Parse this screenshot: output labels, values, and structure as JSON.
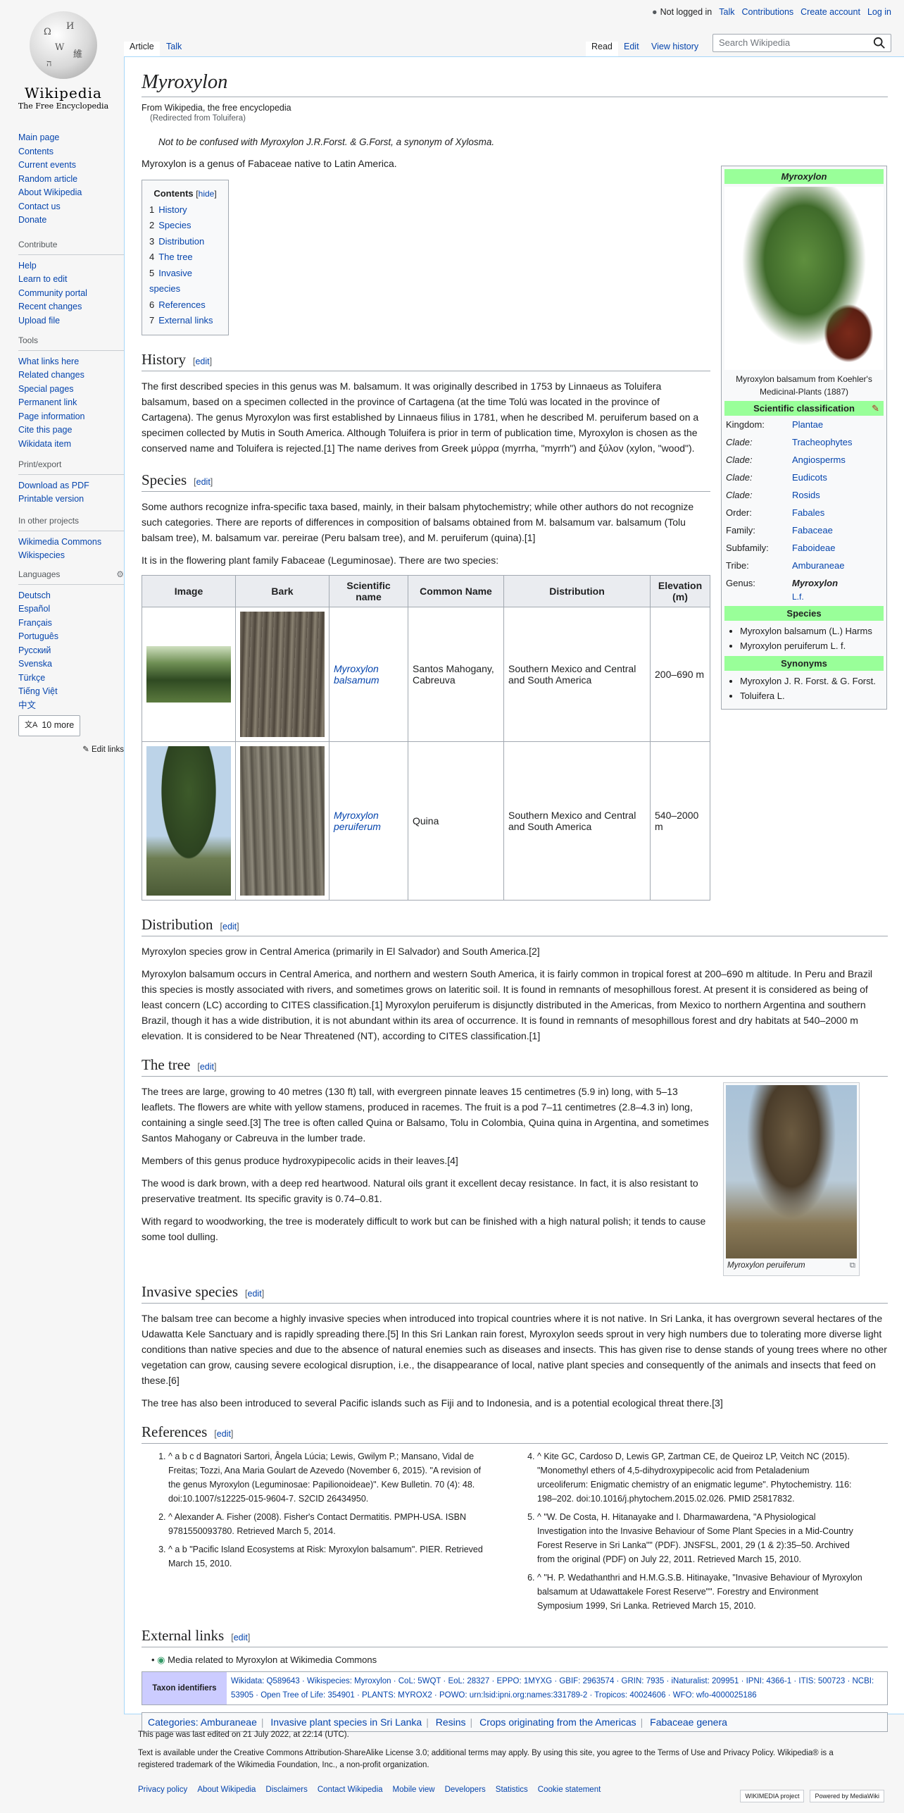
{
  "header": {
    "not_logged_in": "Not logged in",
    "talk": "Talk",
    "contributions": "Contributions",
    "create_account": "Create account",
    "log_in": "Log in",
    "tabs": {
      "article": "Article",
      "talk": "Talk",
      "read": "Read",
      "edit": "Edit",
      "view_history": "View history"
    },
    "search_placeholder": "Search Wikipedia"
  },
  "logo": {
    "wordmark": "Wikipedia",
    "tagline": "The Free Encyclopedia"
  },
  "sidebar": {
    "nav": [
      "Main page",
      "Contents",
      "Current events",
      "Random article",
      "About Wikipedia",
      "Contact us",
      "Donate"
    ],
    "contribute_heading": "Contribute",
    "contribute": [
      "Help",
      "Learn to edit",
      "Community portal",
      "Recent changes",
      "Upload file"
    ],
    "tools_heading": "Tools",
    "tools": [
      "What links here",
      "Related changes",
      "Special pages",
      "Permanent link",
      "Page information",
      "Cite this page",
      "Wikidata item"
    ],
    "print_heading": "Print/export",
    "print": [
      "Download as PDF",
      "Printable version"
    ],
    "projects_heading": "In other projects",
    "projects": [
      "Wikimedia Commons",
      "Wikispecies"
    ],
    "languages_heading": "Languages",
    "languages": [
      "Deutsch",
      "Español",
      "Français",
      "Português",
      "Русский",
      "Svenska",
      "Türkçe",
      "Tiếng Việt",
      "中文"
    ],
    "more_languages": "10 more",
    "edit_links": "Edit links"
  },
  "article": {
    "title": "Myroxylon",
    "from": "From Wikipedia, the free encyclopedia",
    "redirected": "(Redirected from Toluifera)",
    "hatnote": "Not to be confused with Myroxylon J.R.Forst. & G.Forst, a synonym of Xylosma.",
    "intro": "Myroxylon is a genus of Fabaceae native to Latin America.",
    "edit": "edit",
    "toc": {
      "title": "Contents",
      "hide": "hide",
      "items": [
        {
          "n": "1",
          "label": "History"
        },
        {
          "n": "2",
          "label": "Species"
        },
        {
          "n": "3",
          "label": "Distribution"
        },
        {
          "n": "4",
          "label": "The tree"
        },
        {
          "n": "5",
          "label": "Invasive species"
        },
        {
          "n": "6",
          "label": "References"
        },
        {
          "n": "7",
          "label": "External links"
        }
      ]
    },
    "history": {
      "heading": "History",
      "p1": "The first described species in this genus was M. balsamum. It was originally described in 1753 by Linnaeus as Toluifera balsamum, based on a specimen collected in the province of Cartagena (at the time Tolú was located in the province of Cartagena). The genus Myroxylon was first established by Linnaeus filius in 1781, when he described M. peruiferum based on a specimen collected by Mutis in South America. Although Toluifera is prior in term of publication time, Myroxylon is chosen as the conserved name and Toluifera is rejected.[1] The name derives from Greek μύρρα (myrrha, \"myrrh\") and ξύλον (xylon, \"wood\")."
    },
    "species": {
      "heading": "Species",
      "p1": "Some authors recognize infra-specific taxa based, mainly, in their balsam phytochemistry; while other authors do not recognize such categories. There are reports of differences in composition of balsams obtained from M. balsamum var. balsamum (Tolu balsam tree), M. balsamum var. pereirae (Peru balsam tree), and M. peruiferum (quina).[1]",
      "p2": "It is in the flowering plant family Fabaceae (Leguminosae). There are two species:",
      "table_headers": [
        "Image",
        "Bark",
        "Scientific name",
        "Common Name",
        "Distribution",
        "Elevation (m)"
      ],
      "rows": [
        {
          "sci": "Myroxylon balsamum",
          "common": "Santos Mahogany, Cabreuva",
          "dist": "Southern Mexico and Central and South America",
          "elev": "200–690 m"
        },
        {
          "sci": "Myroxylon peruiferum",
          "common": "Quina",
          "dist": "Southern Mexico and Central and South America",
          "elev": "540–2000 m"
        }
      ]
    },
    "distribution": {
      "heading": "Distribution",
      "p1": "Myroxylon species grow in Central America (primarily in El Salvador) and South America.[2]",
      "p2": "Myroxylon balsamum occurs in Central America, and northern and western South America, it is fairly common in tropical forest at 200–690 m altitude. In Peru and Brazil this species is mostly associated with rivers, and sometimes grows on lateritic soil. It is found in remnants of mesophillous forest. At present it is considered as being of least concern (LC) according to CITES classification.[1] Myroxylon peruiferum is disjunctly distributed in the Americas, from Mexico to northern Argentina and southern Brazil, though it has a wide distribution, it is not abundant within its area of occurrence. It is found in remnants of mesophillous forest and dry habitats at 540–2000 m elevation. It is considered to be Near Threatened (NT), according to CITES classification.[1]"
    },
    "tree": {
      "heading": "The tree",
      "p1": "The trees are large, growing to 40 metres (130 ft) tall, with evergreen pinnate leaves 15 centimetres (5.9 in) long, with 5–13 leaflets. The flowers are white with yellow stamens, produced in racemes. The fruit is a pod 7–11 centimetres (2.8–4.3 in) long, containing a single seed.[3] The tree is often called Quina or Balsamo, Tolu in Colombia, Quina quina in Argentina, and sometimes Santos Mahogany or Cabreuva in the lumber trade.",
      "p2": "Members of this genus produce hydroxypipecolic acids in their leaves.[4]",
      "p3": "The wood is dark brown, with a deep red heartwood. Natural oils grant it excellent decay resistance. In fact, it is also resistant to preservative treatment. Its specific gravity is 0.74–0.81.",
      "p4": "With regard to woodworking, the tree is moderately difficult to work but can be finished with a high natural polish; it tends to cause some tool dulling.",
      "caption": "Myroxylon peruiferum"
    },
    "invasive": {
      "heading": "Invasive species",
      "p1": "The balsam tree can become a highly invasive species when introduced into tropical countries where it is not native. In Sri Lanka, it has overgrown several hectares of the Udawatta Kele Sanctuary and is rapidly spreading there.[5] In this Sri Lankan rain forest, Myroxylon seeds sprout in very high numbers due to tolerating more diverse light conditions than native species and due to the absence of natural enemies such as diseases and insects. This has given rise to dense stands of young trees where no other vegetation can grow, causing severe ecological disruption, i.e., the disappearance of local, native plant species and consequently of the animals and insects that feed on these.[6]",
      "p2": "The tree has also been introduced to several Pacific islands such as Fiji and to Indonesia, and is a potential ecological threat there.[3]"
    },
    "references": {
      "heading": "References",
      "items": [
        "^ a b c d Bagnatori Sartori, Ângela Lúcia; Lewis, Gwilym P.; Mansano, Vidal de Freitas; Tozzi, Ana Maria Goulart de Azevedo (November 6, 2015). \"A revision of the genus Myroxylon (Leguminosae: Papilionoideae)\". Kew Bulletin. 70 (4): 48. doi:10.1007/s12225-015-9604-7. S2CID 26434950.",
        "^ Alexander A. Fisher (2008). Fisher's Contact Dermatitis. PMPH-USA. ISBN 9781550093780. Retrieved March 5, 2014.",
        "^ a b \"Pacific Island Ecosystems at Risk: Myroxylon balsamum\". PIER. Retrieved March 15, 2010.",
        "^ Kite GC, Cardoso D, Lewis GP, Zartman CE, de Queiroz LP, Veitch NC (2015). \"Monomethyl ethers of 4,5-dihydroxypipecolic acid from Petaladenium urceoliferum: Enigmatic chemistry of an enigmatic legume\". Phytochemistry. 116: 198–202. doi:10.1016/j.phytochem.2015.02.026. PMID 25817832.",
        "^ \"W. De Costa, H. Hitanayake and I. Dharmawardena, \"A Physiological Investigation into the Invasive Behaviour of Some Plant Species in a Mid-Country Forest Reserve in Sri Lanka\"\" (PDF). JNSFSL, 2001, 29 (1 & 2):35–50. Archived from the original (PDF) on July 22, 2011. Retrieved March 15, 2010.",
        "^ \"H. P. Wedathanthri and H.M.G.S.B. Hitinayake, \"Invasive Behaviour of Myroxylon balsamum at Udawattakele Forest Reserve\"\". Forestry and Environment Symposium 1999, Sri Lanka. Retrieved March 15, 2010."
      ]
    },
    "external": {
      "heading": "External links",
      "commons": "Media related to Myroxylon at Wikimedia Commons",
      "taxon_label": "Taxon identifiers",
      "taxon_values": "Wikidata: Q589643 · Wikispecies: Myroxylon · CoL: 5WQT · EoL: 28327 · EPPO: 1MYXG · GBIF: 2963574 · GRIN: 7935 · iNaturalist: 209951 · IPNI: 4366-1 · ITIS: 500723 · NCBI: 53905 · Open Tree of Life: 354901 · PLANTS: MYROX2 · POWO: urn:lsid:ipni.org:names:331789-2 · Tropicos: 40024606 · WFO: wfo-4000025186"
    },
    "categories_label": "Categories:",
    "categories": [
      "Amburaneae",
      "Invasive plant species in Sri Lanka",
      "Resins",
      "Crops originating from the Americas",
      "Fabaceae genera"
    ]
  },
  "infobox": {
    "title": "Myroxylon",
    "caption": "Myroxylon balsamum from Koehler's Medicinal-Plants (1887)",
    "sci_class": "Scientific classification",
    "rows": [
      {
        "k": "Kingdom:",
        "v": "Plantae"
      },
      {
        "k": "Clade:",
        "v": "Tracheophytes"
      },
      {
        "k": "Clade:",
        "v": "Angiosperms"
      },
      {
        "k": "Clade:",
        "v": "Eudicots"
      },
      {
        "k": "Clade:",
        "v": "Rosids"
      },
      {
        "k": "Order:",
        "v": "Fabales"
      },
      {
        "k": "Family:",
        "v": "Fabaceae"
      },
      {
        "k": "Subfamily:",
        "v": "Faboideae"
      },
      {
        "k": "Tribe:",
        "v": "Amburaneae"
      },
      {
        "k": "Genus:",
        "v": "Myroxylon"
      }
    ],
    "genus_author": "L.f.",
    "species_heading": "Species",
    "species": [
      "Myroxylon balsamum (L.) Harms",
      "Myroxylon peruiferum L. f."
    ],
    "synonyms_heading": "Synonyms",
    "synonyms": [
      "Myroxylon J. R. Forst. & G. Forst.",
      "Toluifera L."
    ]
  },
  "footer": {
    "last_edited": "This page was last edited on 21 July 2022, at 22:14 (UTC).",
    "license": "Text is available under the Creative Commons Attribution-ShareAlike License 3.0; additional terms may apply. By using this site, you agree to the Terms of Use and Privacy Policy. Wikipedia® is a registered trademark of the Wikimedia Foundation, Inc., a non-profit organization.",
    "links": [
      "Privacy policy",
      "About Wikipedia",
      "Disclaimers",
      "Contact Wikipedia",
      "Mobile view",
      "Developers",
      "Statistics",
      "Cookie statement"
    ],
    "badge_wmf": "WIKIMEDIA project",
    "badge_mw": "Powered by MediaWiki"
  }
}
